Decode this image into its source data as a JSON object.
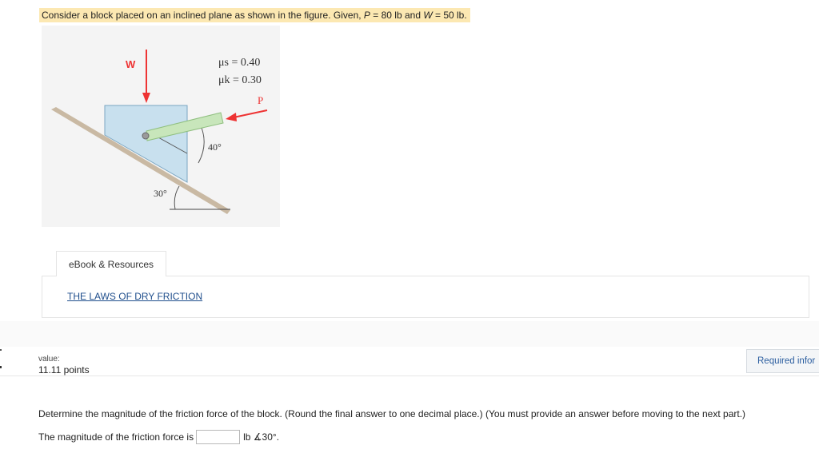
{
  "problem": {
    "intro": "Consider a block placed on an inclined plane as shown in the figure. Given, ",
    "p_var": "P",
    "p_value": " = 80 lb and ",
    "w_var": "W",
    "w_value": " = 50 lb."
  },
  "figure": {
    "w_label": "W",
    "mu_s": "μs = 0.40",
    "mu_k": "μk = 0.30",
    "p_label": "P",
    "angle_40": "40°",
    "angle_30": "30°"
  },
  "ebook": {
    "tab_label": "eBook & Resources",
    "link_label": "THE LAWS OF DRY FRICTION"
  },
  "score": {
    "value_label": "value:",
    "points": "11.11 points"
  },
  "required_button": "Required infor",
  "question": {
    "text": "Determine the magnitude of the friction force of the block. (Round the final answer to one decimal place.) (You must provide an answer before moving to the next part.)",
    "answer_prefix": "The magnitude of the friction force is",
    "answer_value": "",
    "answer_unit": "lb ∡30°."
  }
}
